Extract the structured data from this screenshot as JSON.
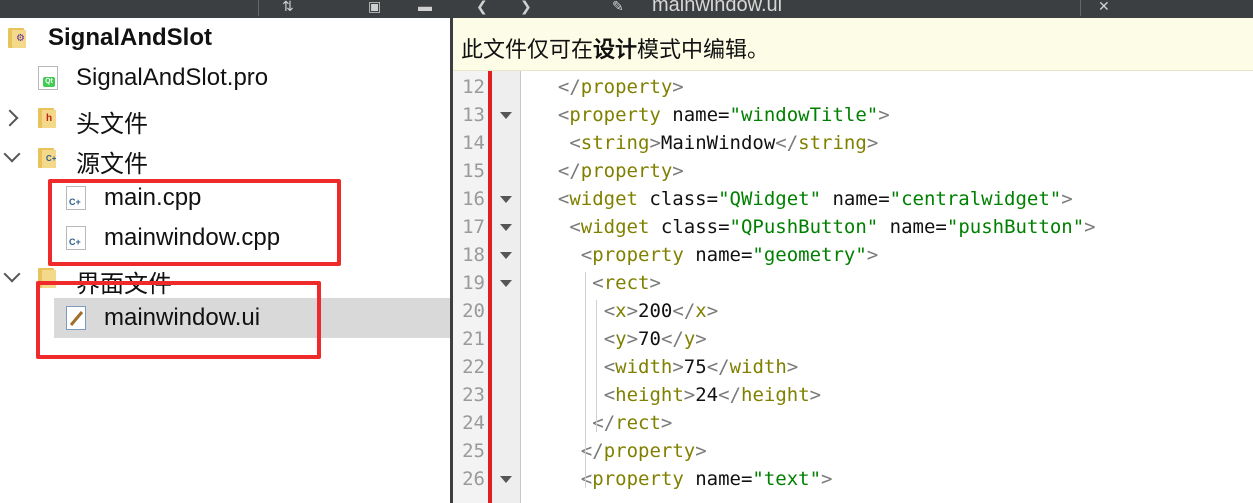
{
  "toolbar": {
    "title": "mainwindow.ui"
  },
  "tree": {
    "project": "SignalAndSlot",
    "items": [
      {
        "label": "SignalAndSlot.pro"
      },
      {
        "label": "头文件"
      },
      {
        "label": "源文件"
      },
      {
        "label": "main.cpp"
      },
      {
        "label": "mainwindow.cpp"
      },
      {
        "label": "界面文件"
      },
      {
        "label": "mainwindow.ui"
      }
    ]
  },
  "editor": {
    "banner_pre": "此文件仅可在",
    "banner_bold": "设计",
    "banner_post": "模式中编辑。",
    "lines": [
      {
        "n": "12",
        "indent": "  ",
        "open": "</",
        "name": "property",
        "attrs": [],
        "close": ">",
        "text": "",
        "endtag": ""
      },
      {
        "n": "13",
        "indent": "  ",
        "open": "<",
        "name": "property",
        "attrs": [
          {
            "k": "name",
            "v": "\"windowTitle\""
          }
        ],
        "close": ">",
        "text": "",
        "endtag": ""
      },
      {
        "n": "14",
        "indent": "   ",
        "open": "<",
        "name": "string",
        "attrs": [],
        "close": ">",
        "text": "MainWindow",
        "endtag": "string"
      },
      {
        "n": "15",
        "indent": "  ",
        "open": "</",
        "name": "property",
        "attrs": [],
        "close": ">",
        "text": "",
        "endtag": ""
      },
      {
        "n": "16",
        "indent": "  ",
        "open": "<",
        "name": "widget",
        "attrs": [
          {
            "k": "class",
            "v": "\"QWidget\""
          },
          {
            "k": "name",
            "v": "\"centralwidget\""
          }
        ],
        "close": ">",
        "text": "",
        "endtag": ""
      },
      {
        "n": "17",
        "indent": "   ",
        "open": "<",
        "name": "widget",
        "attrs": [
          {
            "k": "class",
            "v": "\"QPushButton\""
          },
          {
            "k": "name",
            "v": "\"pushButton\""
          }
        ],
        "close": ">",
        "text": "",
        "endtag": ""
      },
      {
        "n": "18",
        "indent": "    ",
        "open": "<",
        "name": "property",
        "attrs": [
          {
            "k": "name",
            "v": "\"geometry\""
          }
        ],
        "close": ">",
        "text": "",
        "endtag": ""
      },
      {
        "n": "19",
        "indent": "     ",
        "open": "<",
        "name": "rect",
        "attrs": [],
        "close": ">",
        "text": "",
        "endtag": ""
      },
      {
        "n": "20",
        "indent": "      ",
        "open": "<",
        "name": "x",
        "attrs": [],
        "close": ">",
        "text": "200",
        "endtag": "x"
      },
      {
        "n": "21",
        "indent": "      ",
        "open": "<",
        "name": "y",
        "attrs": [],
        "close": ">",
        "text": "70",
        "endtag": "y"
      },
      {
        "n": "22",
        "indent": "      ",
        "open": "<",
        "name": "width",
        "attrs": [],
        "close": ">",
        "text": "75",
        "endtag": "width"
      },
      {
        "n": "23",
        "indent": "      ",
        "open": "<",
        "name": "height",
        "attrs": [],
        "close": ">",
        "text": "24",
        "endtag": "height"
      },
      {
        "n": "24",
        "indent": "     ",
        "open": "</",
        "name": "rect",
        "attrs": [],
        "close": ">",
        "text": "",
        "endtag": ""
      },
      {
        "n": "25",
        "indent": "    ",
        "open": "</",
        "name": "property",
        "attrs": [],
        "close": ">",
        "text": "",
        "endtag": ""
      },
      {
        "n": "26",
        "indent": "    ",
        "open": "<",
        "name": "property",
        "attrs": [
          {
            "k": "name",
            "v": "\"text\""
          }
        ],
        "close": ">",
        "text": "",
        "endtag": ""
      }
    ],
    "fold_lines": [
      "13",
      "16",
      "17",
      "18",
      "19",
      "26"
    ]
  },
  "colors": {
    "highlight_box": "#ee2a2a",
    "banner_bg": "#fdfde7",
    "attr_value": "#008000",
    "tag_name": "#808000"
  }
}
